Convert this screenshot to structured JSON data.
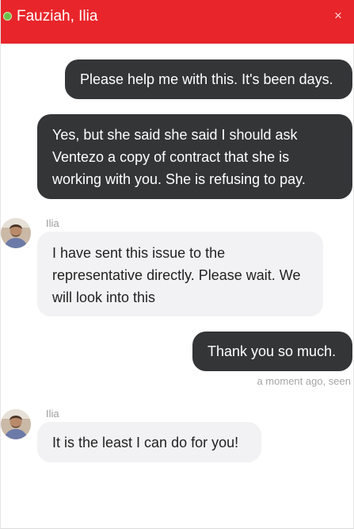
{
  "header": {
    "title": "Fauziah, Ilia",
    "close_label": "×",
    "status_color": "#6cc04a",
    "background_color": "#e8252a"
  },
  "messages": [
    {
      "direction": "outgoing",
      "lines": [
        "Please help me with this. It's been days."
      ]
    },
    {
      "direction": "outgoing",
      "lines": [
        "Yes, but she said she said I should ask",
        "Ventezo a copy of contract that she is",
        "working with you. She is refusing to pay."
      ]
    },
    {
      "direction": "incoming",
      "sender": "Ilia",
      "avatar_icon": "user-avatar-photo",
      "lines": [
        "I have sent this issue to the",
        "representative directly. Please wait. We",
        "will look into this"
      ]
    },
    {
      "direction": "outgoing",
      "lines": [
        "Thank you so much."
      ],
      "meta": "a moment ago, seen"
    },
    {
      "direction": "incoming",
      "sender": "Ilia",
      "avatar_icon": "user-avatar-photo",
      "lines": [
        "It is the least I can do for you!"
      ]
    }
  ],
  "colors": {
    "outgoing_bubble": "#333537",
    "incoming_bubble": "#f2f2f4"
  }
}
